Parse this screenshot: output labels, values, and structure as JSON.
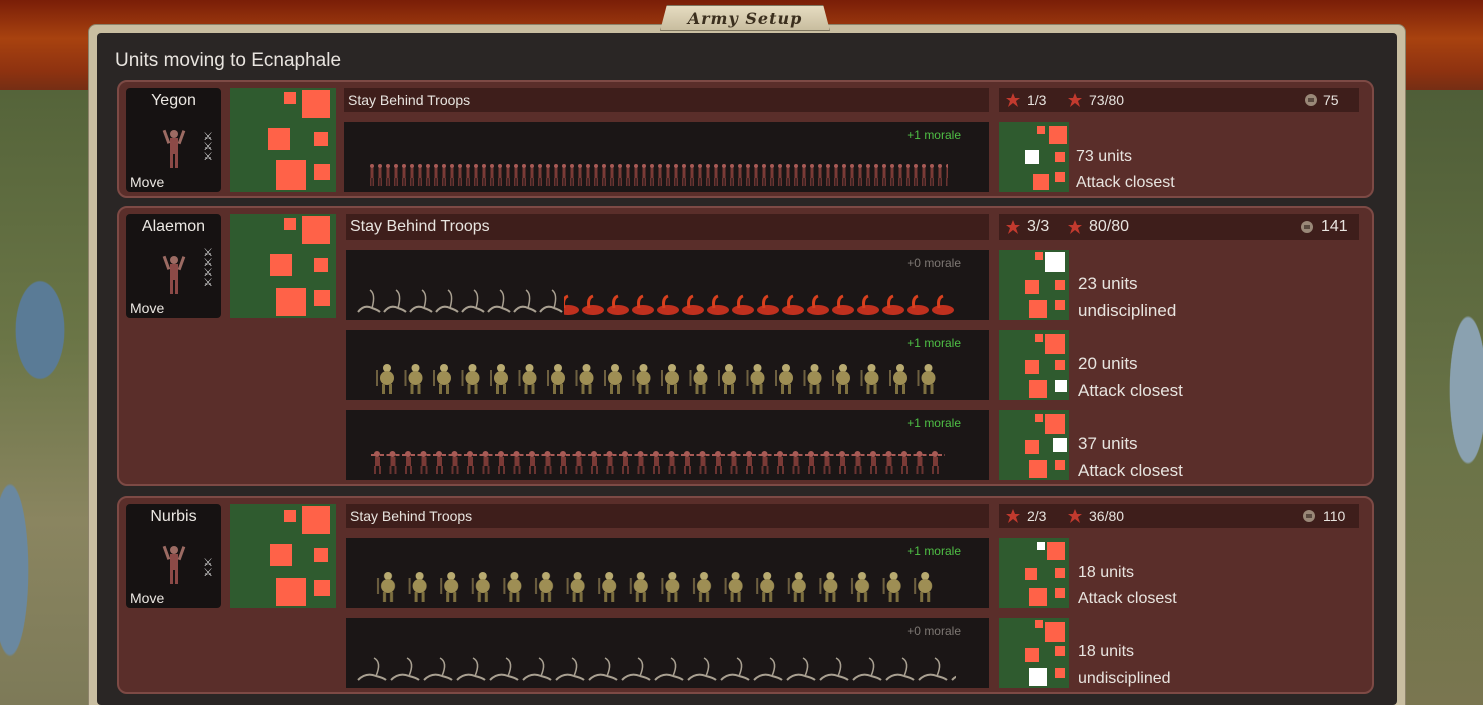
{
  "window": {
    "title": "Army Setup"
  },
  "heading": "Units moving to Ecnaphale",
  "colors": {
    "formation_green": "#2f5b2f",
    "unit_square": "#ff6248",
    "morale_positive": "#4fbf45",
    "morale_zero": "#7d7773"
  },
  "commanders": [
    {
      "name": "Yegon",
      "move_label": "Move",
      "stance": "Stay Behind Troops",
      "squads": "1/3",
      "troops": "73/80",
      "strength": "75",
      "rows": [
        {
          "morale": "+1 morale",
          "units": "73 units",
          "order": "Attack closest",
          "sprite": "demon-red-small"
        }
      ]
    },
    {
      "name": "Alaemon",
      "move_label": "Move",
      "stance": "Stay Behind Troops",
      "squads": "3/3",
      "troops": "80/80",
      "strength": "141",
      "rows": [
        {
          "morale": "+0 morale",
          "units": "23 units",
          "order": "undisciplined",
          "sprite": "scorpion-hellhound"
        },
        {
          "morale": "+1 morale",
          "units": "20 units",
          "order": "Attack closest",
          "sprite": "ghoul-yellow"
        },
        {
          "morale": "+1 morale",
          "units": "37 units",
          "order": "Attack closest",
          "sprite": "demon-red-small"
        }
      ]
    },
    {
      "name": "Nurbis",
      "move_label": "Move",
      "stance": "Stay Behind Troops",
      "squads": "2/3",
      "troops": "36/80",
      "strength": "110",
      "rows": [
        {
          "morale": "+1 morale",
          "units": "18 units",
          "order": "Attack closest",
          "sprite": "ghoul-yellow"
        },
        {
          "morale": "+0 morale",
          "units": "18 units",
          "order": "undisciplined",
          "sprite": "scorpion"
        }
      ]
    }
  ]
}
